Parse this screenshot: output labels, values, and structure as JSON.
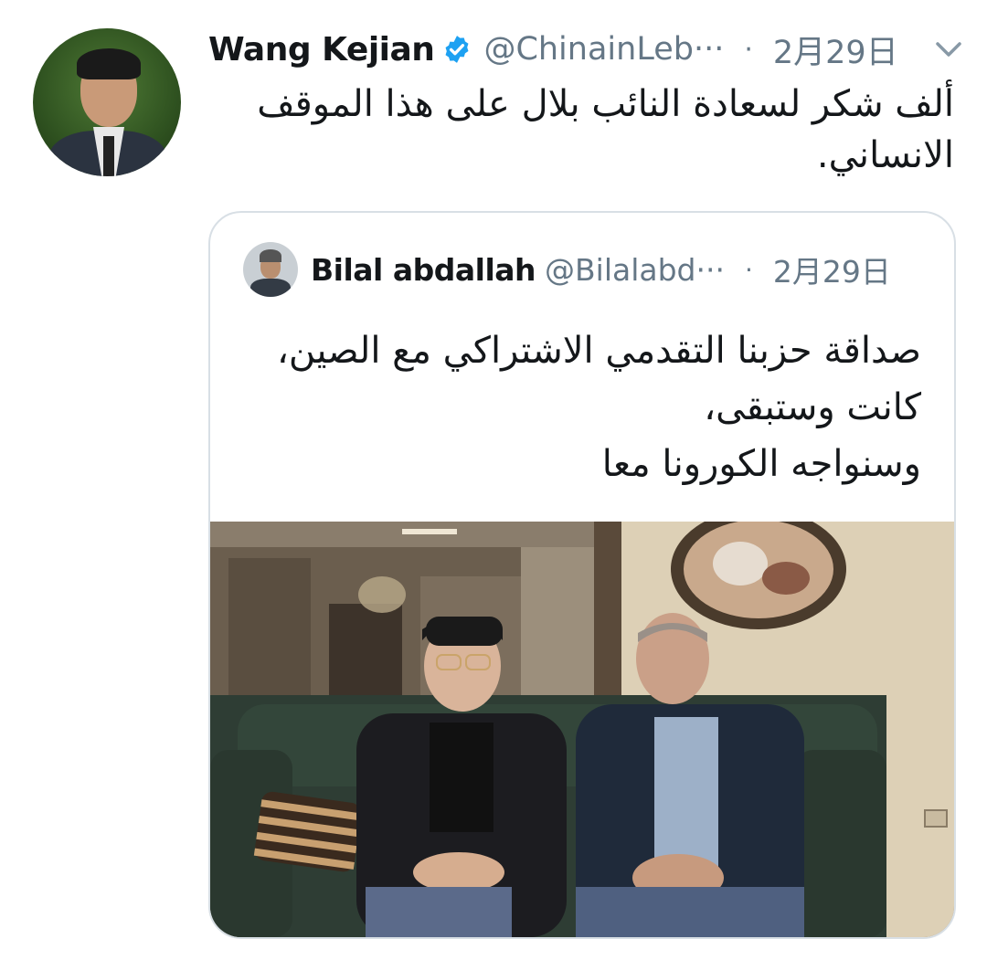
{
  "tweet": {
    "author_name": "Wang Kejian",
    "author_handle": "@ChinainLeb···",
    "separator": "·",
    "date": "2月29日",
    "text_line1": "ألف شكر لسعادة النائب بلال على هذا الموقف",
    "text_line2": "الانساني.",
    "verified": true
  },
  "quoted": {
    "author_name": "Bilal abdallah",
    "author_handle": "@Bilalabd···",
    "separator": "·",
    "date": "2月29日",
    "lines": [
      "صداقة حزبنا التقدمي الاشتراكي مع الصين،",
      "كانت وستبقى،",
      "وسنواجه الكورونا معا"
    ]
  },
  "icons": {
    "verified": "verified-badge-icon",
    "menu": "chevron-down-icon"
  },
  "colors": {
    "text_primary": "#14171a",
    "text_secondary": "#657786",
    "verified_blue": "#1da1f2",
    "card_border": "#d8dfe5"
  }
}
